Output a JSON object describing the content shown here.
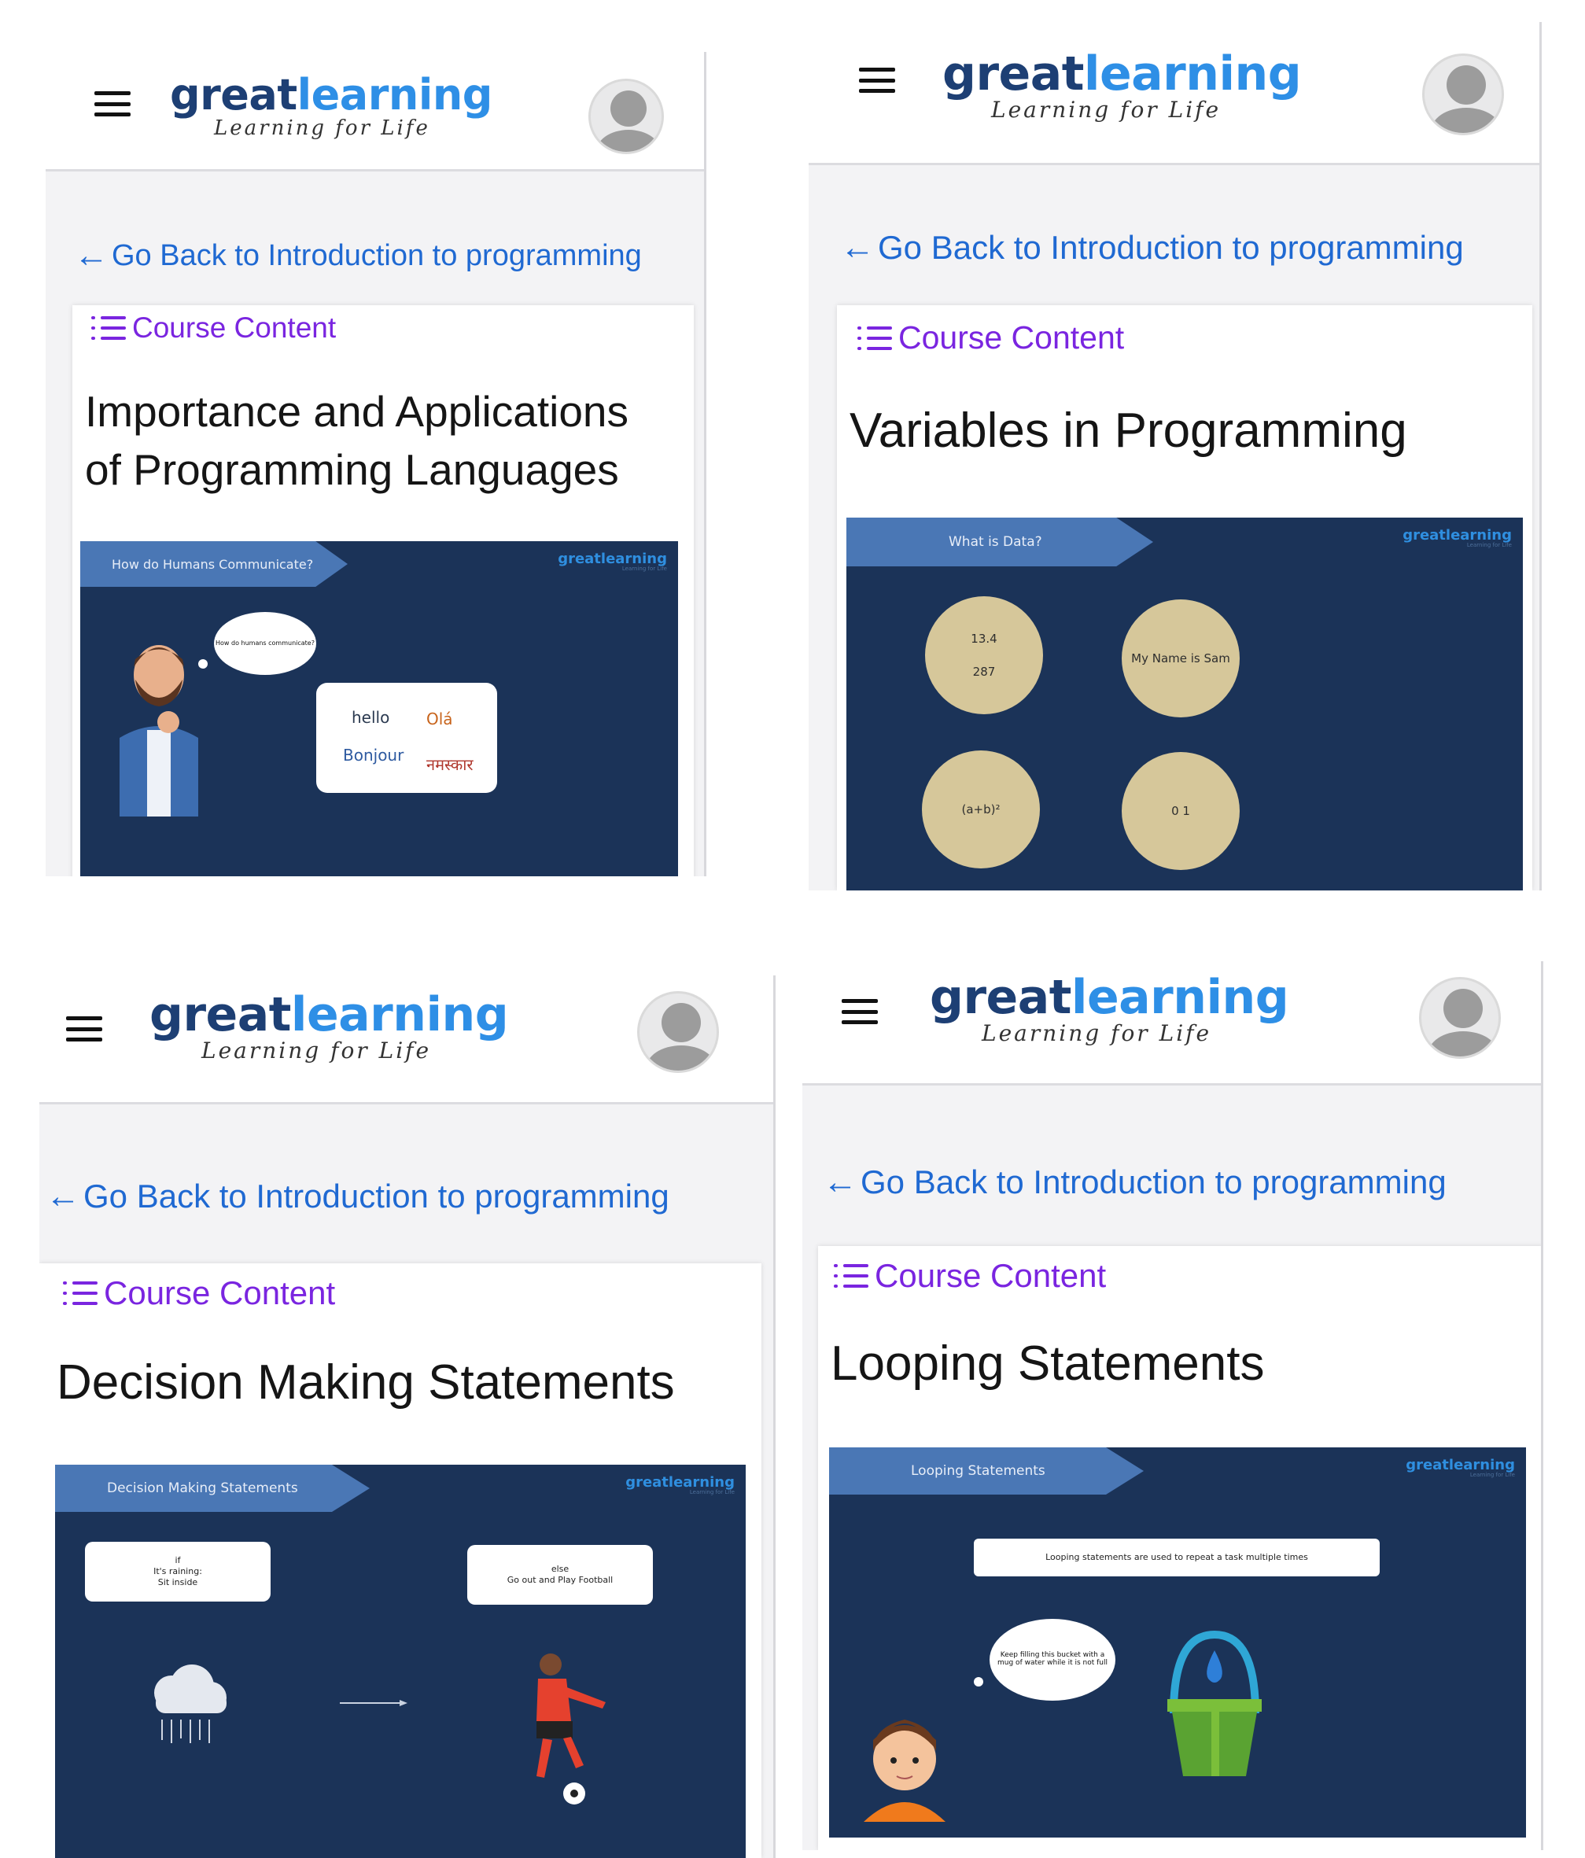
{
  "logo": {
    "great": "great",
    "learning": "learning",
    "tagline": "Learning for Life"
  },
  "back_link": "Go Back to Introduction to programming",
  "course_content": "Course Content",
  "panels": [
    {
      "title_line1": "Importance and Applications",
      "title_line2": "of Programming Languages",
      "slide": {
        "ribbon": "How do Humans Communicate?",
        "logo": "greatlearning",
        "thought": "How do humans communicate?",
        "greetings": [
          "hello",
          "Olá",
          "Bonjour",
          "नमस्कार"
        ]
      }
    },
    {
      "title_line1": "Variables in Programming",
      "slide": {
        "ribbon": "What is Data?",
        "logo": "greatlearning",
        "circles": [
          {
            "line1": "13.4",
            "line2": "287"
          },
          {
            "line1": "My Name is Sam",
            "line2": ""
          },
          {
            "line1": "(a+b)²",
            "line2": ""
          },
          {
            "line1": "0 1",
            "line2": ""
          }
        ]
      }
    },
    {
      "title_line1": "Decision Making Statements",
      "slide": {
        "ribbon": "Decision Making Statements",
        "logo": "greatlearning",
        "if_box": [
          "if",
          "It's raining:",
          "Sit inside"
        ],
        "else_box": [
          "else",
          "Go out and Play Football"
        ]
      }
    },
    {
      "title_line1": "Looping Statements",
      "slide": {
        "ribbon": "Looping Statements",
        "logo": "greatlearning",
        "banner": "Looping statements are used to repeat a task multiple times",
        "thought": "Keep filling this bucket with a mug of water while it is not full"
      }
    }
  ],
  "colors": {
    "brand_dark": "#1d3f74",
    "brand_light": "#2e8fe6",
    "link": "#1f69d2",
    "course": "#7a25e0",
    "slide_bg": "#1b3358"
  }
}
